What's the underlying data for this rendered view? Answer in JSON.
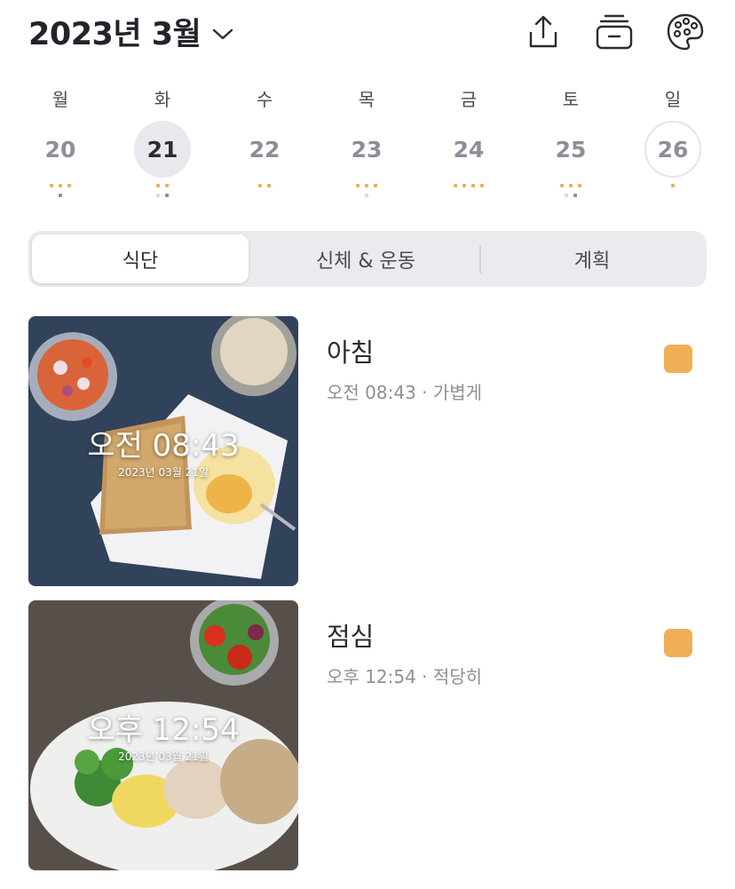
{
  "header": {
    "month_title": "2023년 3월",
    "icons": [
      "chevron-down-icon",
      "share-icon",
      "archive-icon",
      "palette-icon"
    ]
  },
  "week": {
    "days": [
      {
        "name": "월",
        "num": "20",
        "state": "normal"
      },
      {
        "name": "화",
        "num": "21",
        "state": "selected"
      },
      {
        "name": "수",
        "num": "22",
        "state": "normal"
      },
      {
        "name": "목",
        "num": "23",
        "state": "normal"
      },
      {
        "name": "금",
        "num": "24",
        "state": "normal"
      },
      {
        "name": "토",
        "num": "25",
        "state": "normal"
      },
      {
        "name": "일",
        "num": "26",
        "state": "today"
      }
    ]
  },
  "tabs": [
    {
      "label": "식단",
      "active": true
    },
    {
      "label": "신체 & 운동",
      "active": false
    },
    {
      "label": "계획",
      "active": false
    }
  ],
  "meals": [
    {
      "name": "아침",
      "subtitle": "오전 08:43 · 가볍게",
      "photo_time": "오전 08:43",
      "photo_date": "2023년 03월 21일",
      "flag_color": "#f0ae57"
    },
    {
      "name": "점심",
      "subtitle": "오후 12:54 · 적당히",
      "photo_time": "오후 12:54",
      "photo_date": "2023년 03월 21일",
      "flag_color": "#f0ae57"
    }
  ],
  "colors": {
    "accent_orange": "#f0ae57",
    "dot_gray": "#8e8e98",
    "dot_light": "#d6d6dc",
    "selected_day_bg": "#e8e8ee"
  }
}
